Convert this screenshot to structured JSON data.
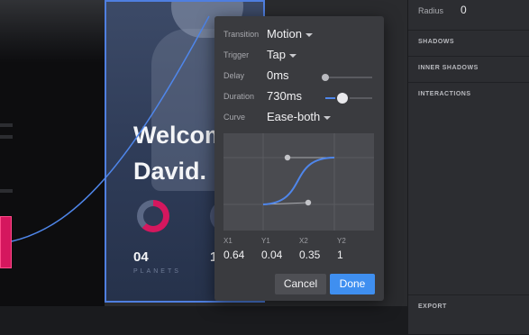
{
  "artboard": {
    "welcome_line1": "Welcome",
    "welcome_line2": "David.",
    "stat_value": "04",
    "stat_value2": "1",
    "stat_label": "PLANETS"
  },
  "popover": {
    "transition": {
      "label": "Transition",
      "value": "Motion"
    },
    "trigger": {
      "label": "Trigger",
      "value": "Tap"
    },
    "delay": {
      "label": "Delay",
      "value": "0ms",
      "slider": 0.0
    },
    "duration": {
      "label": "Duration",
      "value": "730ms",
      "slider": 0.37
    },
    "curve": {
      "label": "Curve",
      "value": "Ease-both"
    },
    "coords": {
      "labels": [
        "X1",
        "Y1",
        "X2",
        "Y2"
      ],
      "values": [
        "0.64",
        "0.04",
        "0.35",
        "1"
      ]
    },
    "cancel_label": "Cancel",
    "done_label": "Done"
  },
  "inspector": {
    "radius_label": "Radius",
    "radius_value": "0",
    "sections": [
      "SHADOWS",
      "INNER SHADOWS",
      "INTERACTIONS",
      "EXPORT"
    ]
  },
  "colors": {
    "accent": "#3f8ff0",
    "pink": "#d5175e",
    "artboard_border": "#4f7fe0"
  }
}
